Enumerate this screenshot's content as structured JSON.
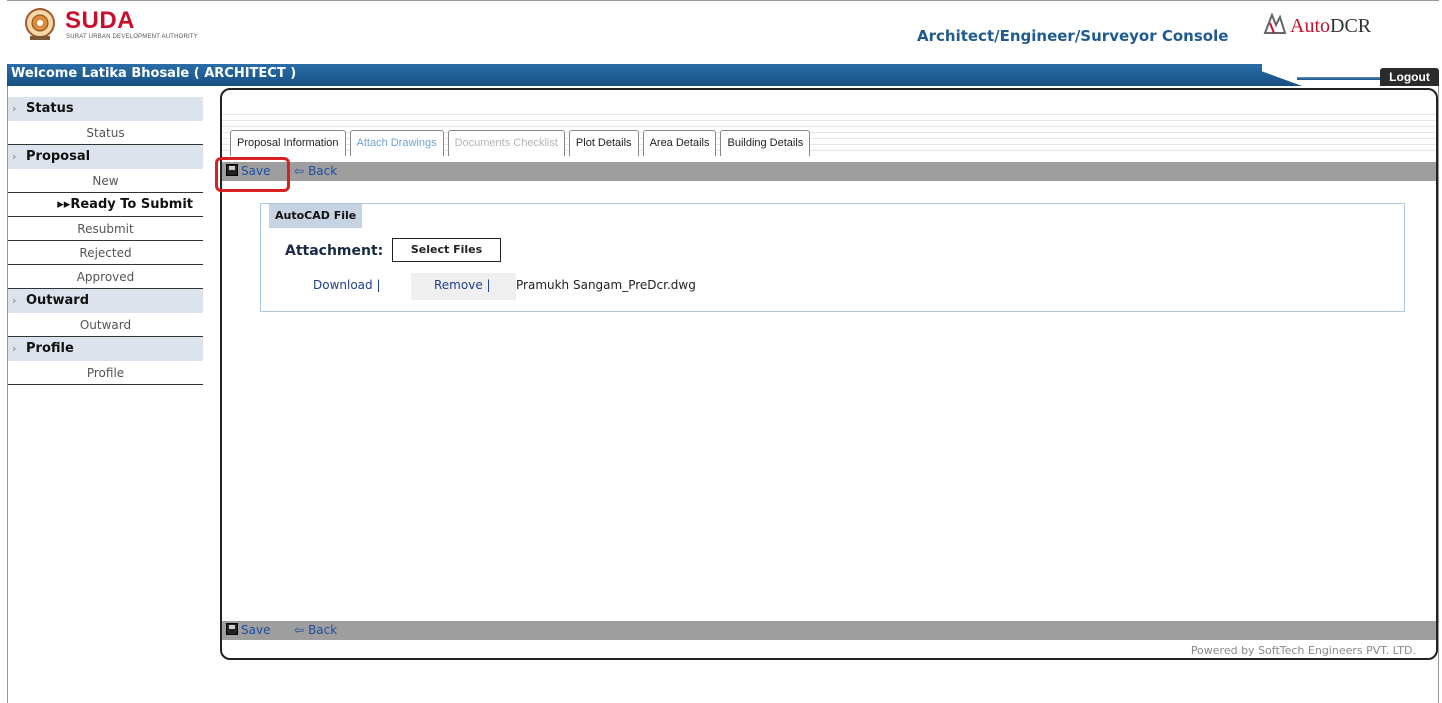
{
  "header": {
    "logo_text": "SUDA",
    "logo_sub": "SURAT URBAN DEVELOPMENT AUTHORITY",
    "console_title": "Architect/Engineer/Surveyor Console",
    "brand_prefix": "Auto",
    "brand_suffix": "DCR"
  },
  "welcome": {
    "text": "Welcome Latika Bhosale ( ARCHITECT )",
    "logout_label": "Logout"
  },
  "sidebar": {
    "groups": [
      {
        "title": "Status",
        "items": [
          "Status"
        ]
      },
      {
        "title": "Proposal",
        "items": [
          "New",
          "Ready To Submit",
          "Resubmit",
          "Rejected",
          "Approved"
        ]
      },
      {
        "title": "Outward",
        "items": [
          "Outward"
        ]
      },
      {
        "title": "Profile",
        "items": [
          "Profile"
        ]
      }
    ],
    "active_prefix": "▸▸"
  },
  "tabs": [
    {
      "label": "Proposal Information",
      "state": "normal"
    },
    {
      "label": "Attach Drawings",
      "state": "current"
    },
    {
      "label": "Documents Checklist",
      "state": "disabled"
    },
    {
      "label": "Plot Details",
      "state": "normal"
    },
    {
      "label": "Area Details",
      "state": "normal"
    },
    {
      "label": "Building Details",
      "state": "normal"
    }
  ],
  "toolbar": {
    "save_label": "Save",
    "back_label": "Back"
  },
  "section": {
    "title": "AutoCAD File",
    "attachment_label": "Attachment:",
    "select_files_label": "Select Files",
    "download_label": "Download |",
    "remove_label": "Remove |",
    "file_name": "Pramukh Sangam_PreDcr.dwg"
  },
  "footer": {
    "powered_by": "Powered by SoftTech Engineers PVT. LTD."
  },
  "colors": {
    "brand_red": "#c8102e",
    "bar_blue": "#1f5b8f",
    "link_blue": "#1f4ea0",
    "highlight_red": "#d92020"
  }
}
